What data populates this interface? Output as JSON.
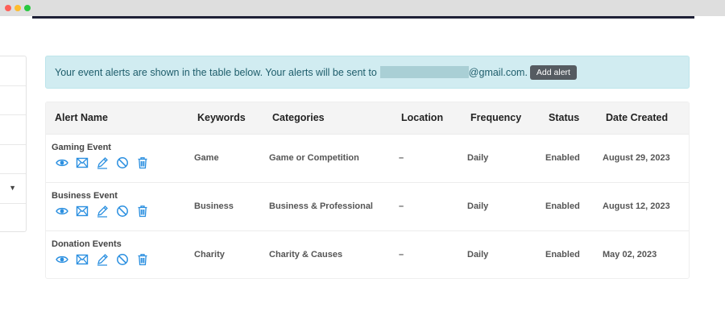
{
  "alert": {
    "message": "Your event alerts are shown in the table below. Your alerts will be sent to",
    "email_suffix": "@gmail.com.",
    "add_label": "Add alert"
  },
  "table": {
    "headers": [
      "Alert Name",
      "Keywords",
      "Categories",
      "Location",
      "Frequency",
      "Status",
      "Date Created"
    ],
    "rows": [
      {
        "name": "Gaming Event",
        "keywords": "Game",
        "category": "Game or Competition",
        "location": "–",
        "frequency": "Daily",
        "status": "Enabled",
        "date": "August 29, 2023"
      },
      {
        "name": "Business Event",
        "keywords": "Business",
        "category": "Business & Professional",
        "location": "–",
        "frequency": "Daily",
        "status": "Enabled",
        "date": "August 12, 2023"
      },
      {
        "name": "Donation Events",
        "keywords": "Charity",
        "category": "Charity & Causes",
        "location": "–",
        "frequency": "Daily",
        "status": "Enabled",
        "date": "May 02, 2023"
      }
    ]
  },
  "icons": [
    "eye-icon",
    "envelope-icon",
    "pencil-icon",
    "disable-icon",
    "trash-icon"
  ],
  "colors": {
    "accent": "#2a8fe0",
    "alert_bg": "#d1ecf1",
    "alert_text": "#1e5d6b",
    "button_bg": "#555b61"
  }
}
